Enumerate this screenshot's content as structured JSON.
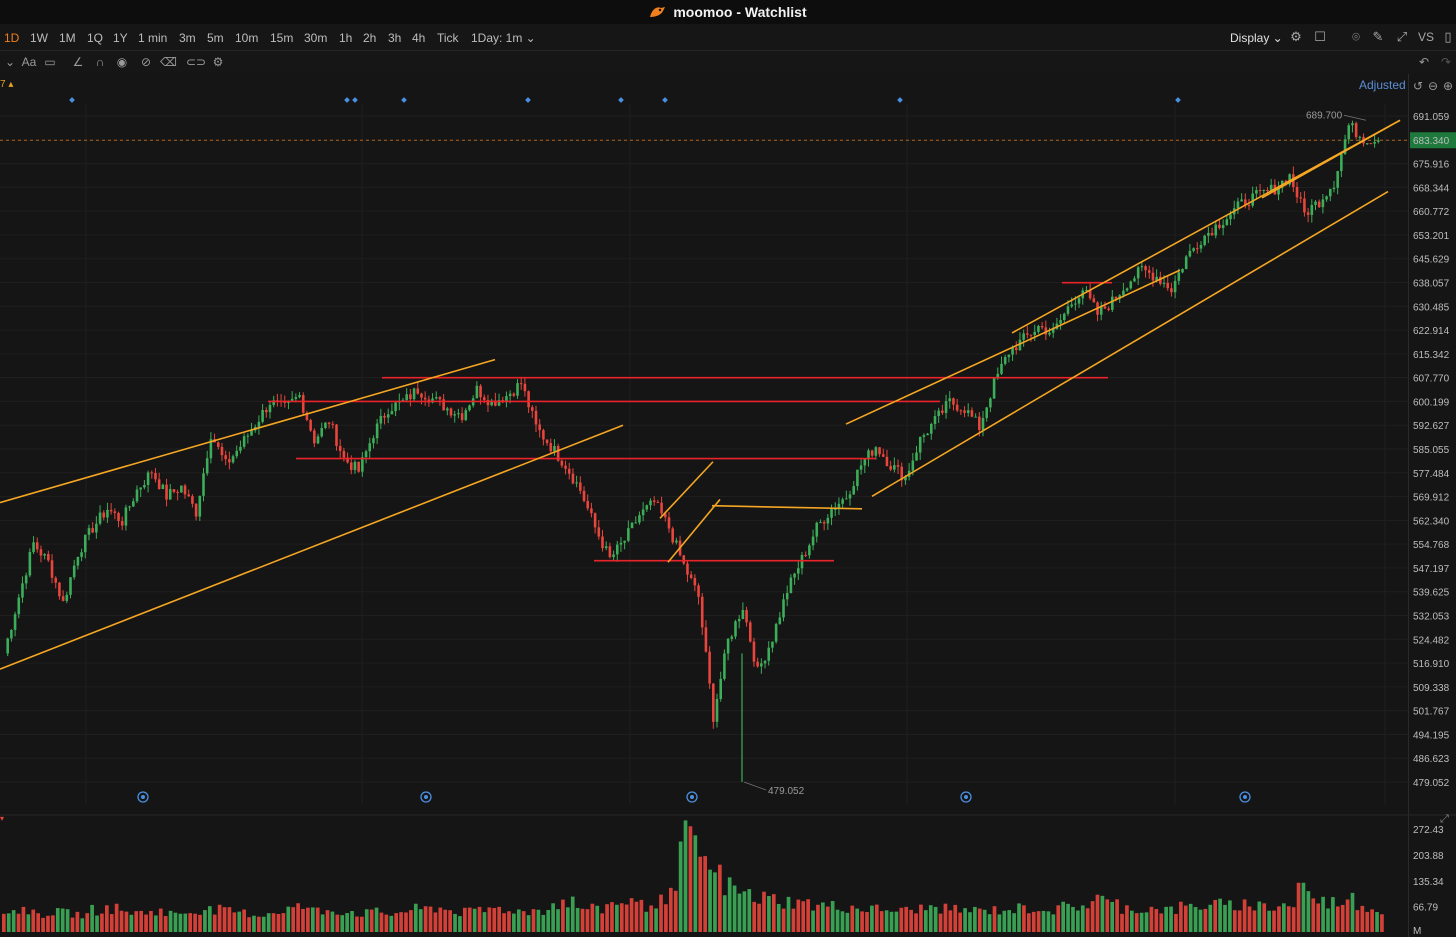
{
  "window": {
    "title": "moomoo - Watchlist"
  },
  "timeframes": [
    {
      "label": "1D",
      "active": true
    },
    {
      "label": "1W",
      "active": false
    },
    {
      "label": "1M",
      "active": false
    },
    {
      "label": "1Q",
      "active": false
    },
    {
      "label": "1Y",
      "active": false
    },
    {
      "label": "1 min",
      "active": false
    },
    {
      "label": "3m",
      "active": false
    },
    {
      "label": "5m",
      "active": false
    },
    {
      "label": "10m",
      "active": false
    },
    {
      "label": "15m",
      "active": false
    },
    {
      "label": "30m",
      "active": false
    },
    {
      "label": "1h",
      "active": false
    },
    {
      "label": "2h",
      "active": false
    },
    {
      "label": "3h",
      "active": false
    },
    {
      "label": "4h",
      "active": false
    },
    {
      "label": "Tick",
      "active": false
    },
    {
      "label": "1Day: 1m ⌄",
      "active": false
    }
  ],
  "toolbar": {
    "display_label": "Display ⌄",
    "vs_label": "VS",
    "adjusted_label": "Adjusted"
  },
  "left_indicator": "7 ▴",
  "price_axis": {
    "ticks": [
      "691.059",
      "683.340",
      "675.916",
      "668.344",
      "660.772",
      "653.201",
      "645.629",
      "638.057",
      "630.485",
      "622.914",
      "615.342",
      "607.770",
      "600.199",
      "592.627",
      "585.055",
      "577.484",
      "569.912",
      "562.340",
      "554.768",
      "547.197",
      "539.625",
      "532.053",
      "524.482",
      "516.910",
      "509.338",
      "501.767",
      "494.195",
      "486.623",
      "479.052"
    ],
    "current_price": "683.340",
    "current_price_color": "#1e7a3c"
  },
  "volume_axis": {
    "ticks": [
      "272.43",
      "203.88",
      "135.34",
      "66.79"
    ],
    "unit": "M"
  },
  "colors": {
    "up": "#3cae5a",
    "down": "#e8453c",
    "channel": "#f5a623",
    "level": "#e8232a",
    "accent": "#f0801e"
  },
  "chart_data": {
    "type": "candlestick",
    "title": "",
    "ylim": [
      479.052,
      691.059
    ],
    "grid": true,
    "annotations": [
      {
        "text": "689.700",
        "kind": "high"
      },
      {
        "text": "479.052",
        "kind": "low"
      }
    ],
    "close_series": [
      520,
      538,
      555,
      549,
      536,
      552,
      560,
      566,
      562,
      572,
      578,
      570,
      573,
      565,
      590,
      580,
      586,
      593,
      600,
      598,
      602,
      588,
      594,
      582,
      578,
      590,
      598,
      600,
      604,
      601,
      598,
      596,
      604,
      600,
      602,
      606,
      592,
      586,
      580,
      572,
      560,
      550,
      556,
      564,
      568,
      560,
      548,
      538,
      500,
      524,
      535,
      514,
      525,
      540,
      550,
      560,
      566,
      570,
      580,
      586,
      580,
      576,
      588,
      594,
      600,
      598,
      592,
      606,
      616,
      620,
      624,
      622,
      630,
      636,
      628,
      632,
      638,
      642,
      640,
      636,
      646,
      652,
      656,
      660,
      664,
      666,
      668,
      672,
      660,
      664,
      670,
      688,
      684,
      683.34
    ],
    "horizontal_levels": [
      607.77,
      600.199,
      582.0,
      549.5
    ],
    "volume": [
      55,
      60,
      48,
      52,
      50,
      46,
      58,
      62,
      54,
      50,
      56,
      48,
      52,
      60,
      58,
      54,
      50,
      46,
      52,
      62,
      66,
      56,
      58,
      54,
      50,
      52,
      48,
      56,
      60,
      64,
      58,
      52,
      56,
      62,
      60,
      54,
      58,
      72,
      80,
      64,
      60,
      74,
      84,
      70,
      80,
      95,
      240,
      210,
      150,
      120,
      100,
      90,
      88,
      80,
      76,
      70,
      68,
      66,
      62,
      60,
      58,
      56,
      62,
      64,
      60,
      58,
      56,
      58,
      60,
      62,
      64,
      58,
      66,
      70,
      90,
      74,
      64,
      60,
      62,
      58,
      66,
      70,
      72,
      68,
      74,
      70,
      66,
      72,
      120,
      80,
      78,
      88,
      70,
      60
    ]
  }
}
